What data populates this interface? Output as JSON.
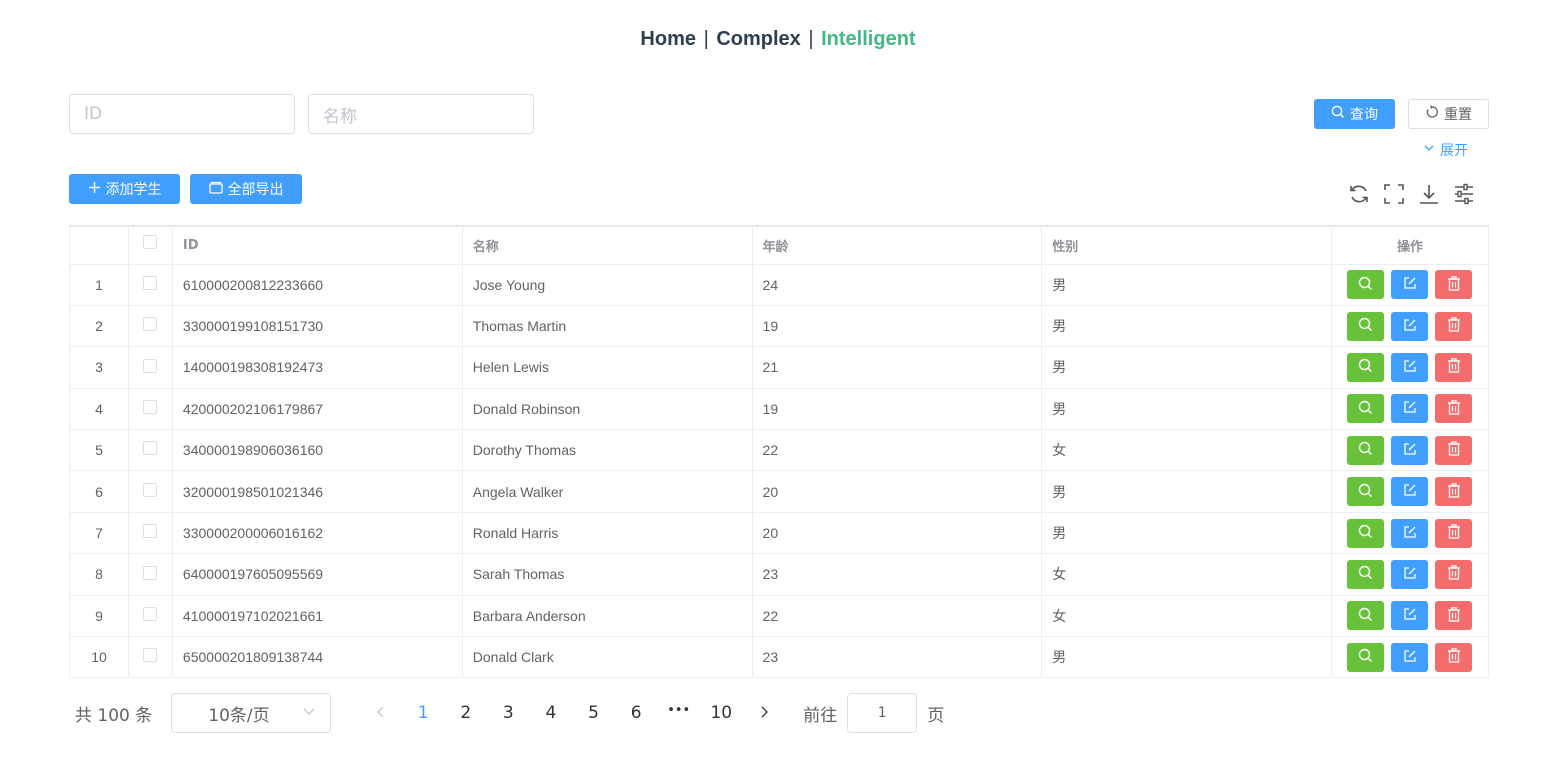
{
  "nav": {
    "links": [
      {
        "label": "Home"
      },
      {
        "label": "Complex"
      },
      {
        "label": "Intelligent",
        "active": true
      }
    ],
    "separator": "|"
  },
  "search": {
    "id_placeholder": "ID",
    "name_placeholder": "名称",
    "query_label": "查询",
    "reset_label": "重置",
    "expand_label": "展开"
  },
  "toolbar": {
    "add_label": "添加学生",
    "export_label": "全部导出",
    "icons": [
      "refresh-icon",
      "fullscreen-icon",
      "download-icon",
      "column-settings-icon"
    ]
  },
  "table": {
    "columns": [
      "",
      "",
      "ID",
      "名称",
      "年龄",
      "性别",
      "操作"
    ],
    "rows": [
      {
        "index": "1",
        "id": "610000200812233660",
        "name": "Jose Young",
        "age": "24",
        "gender": "男"
      },
      {
        "index": "2",
        "id": "330000199108151730",
        "name": "Thomas Martin",
        "age": "19",
        "gender": "男"
      },
      {
        "index": "3",
        "id": "140000198308192473",
        "name": "Helen Lewis",
        "age": "21",
        "gender": "男"
      },
      {
        "index": "4",
        "id": "420000202106179867",
        "name": "Donald Robinson",
        "age": "19",
        "gender": "男"
      },
      {
        "index": "5",
        "id": "340000198906036160",
        "name": "Dorothy Thomas",
        "age": "22",
        "gender": "女"
      },
      {
        "index": "6",
        "id": "320000198501021346",
        "name": "Angela Walker",
        "age": "20",
        "gender": "男"
      },
      {
        "index": "7",
        "id": "330000200006016162",
        "name": "Ronald Harris",
        "age": "20",
        "gender": "男"
      },
      {
        "index": "8",
        "id": "640000197605095569",
        "name": "Sarah Thomas",
        "age": "23",
        "gender": "女"
      },
      {
        "index": "9",
        "id": "410000197102021661",
        "name": "Barbara Anderson",
        "age": "22",
        "gender": "女"
      },
      {
        "index": "10",
        "id": "650000201809138744",
        "name": "Donald Clark",
        "age": "23",
        "gender": "男"
      }
    ]
  },
  "pagination": {
    "total_label": "共 100 条",
    "page_size": "10条/页",
    "pages": [
      "1",
      "2",
      "3",
      "4",
      "5",
      "6",
      "•••",
      "10"
    ],
    "current_page": "1",
    "goto_label": "前往",
    "goto_value": "1",
    "page_suffix": "页"
  },
  "colors": {
    "primary": "#409eff",
    "success": "#67c23a",
    "danger": "#f56c6c",
    "active_nav": "#42b983"
  }
}
